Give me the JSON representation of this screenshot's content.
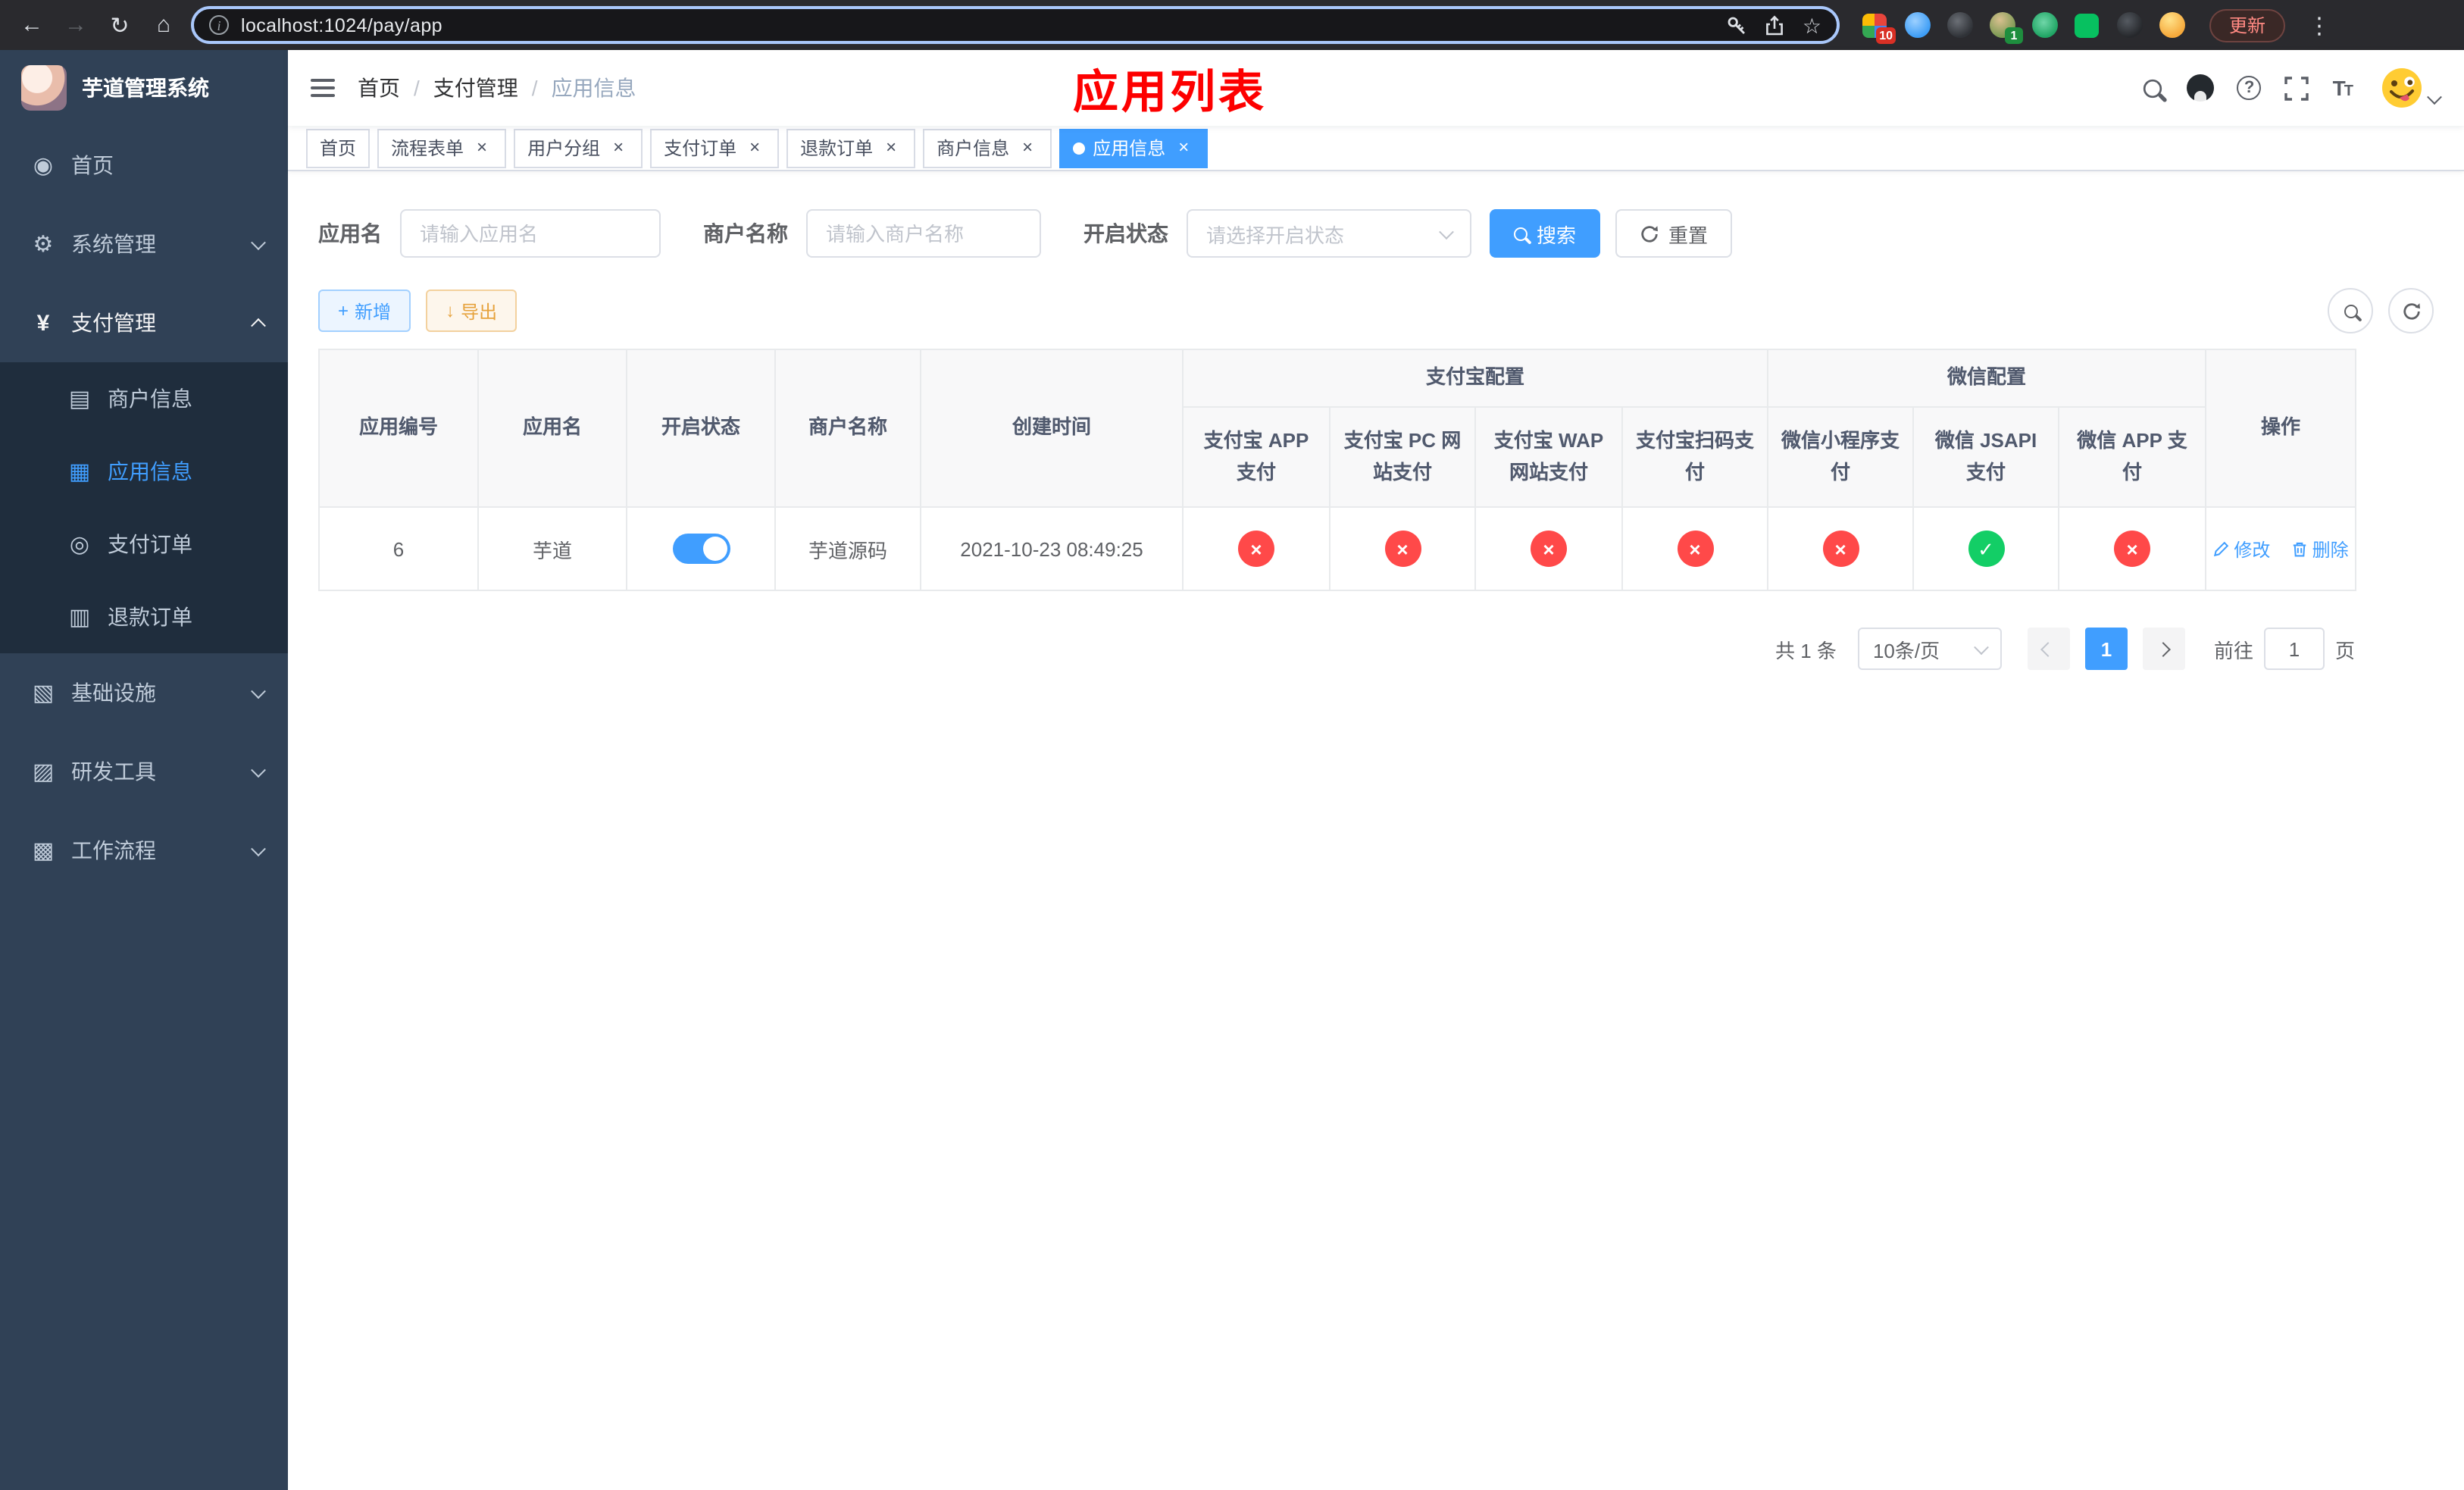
{
  "browser": {
    "url": "localhost:1024/pay/app",
    "update_label": "更新",
    "ext_badge_puzzle": "10",
    "ext_badge_avatar": "1"
  },
  "sidebar": {
    "title": "芋道管理系统",
    "items": [
      {
        "label": "首页"
      },
      {
        "label": "系统管理"
      },
      {
        "label": "支付管理",
        "children": [
          {
            "label": "商户信息"
          },
          {
            "label": "应用信息"
          },
          {
            "label": "支付订单"
          },
          {
            "label": "退款订单"
          }
        ]
      },
      {
        "label": "基础设施"
      },
      {
        "label": "研发工具"
      },
      {
        "label": "工作流程"
      }
    ]
  },
  "header": {
    "breadcrumb": [
      "首页",
      "支付管理",
      "应用信息"
    ],
    "page_title": "应用列表"
  },
  "tabs": [
    {
      "label": "首页"
    },
    {
      "label": "流程表单"
    },
    {
      "label": "用户分组"
    },
    {
      "label": "支付订单"
    },
    {
      "label": "退款订单"
    },
    {
      "label": "商户信息"
    },
    {
      "label": "应用信息"
    }
  ],
  "filters": {
    "app_name_label": "应用名",
    "app_name_placeholder": "请输入应用名",
    "merchant_label": "商户名称",
    "merchant_placeholder": "请输入商户名称",
    "status_label": "开启状态",
    "status_placeholder": "请选择开启状态",
    "search_button": "搜索",
    "reset_button": "重置"
  },
  "toolbar": {
    "add_button": "新增",
    "export_button": "导出"
  },
  "table": {
    "groups": [
      "支付宝配置",
      "微信配置"
    ],
    "columns": [
      "应用编号",
      "应用名",
      "开启状态",
      "商户名称",
      "创建时间",
      "支付宝 APP 支付",
      "支付宝 PC 网站支付",
      "支付宝 WAP 网站支付",
      "支付宝扫码支付",
      "微信小程序支付",
      "微信 JSAPI 支付",
      "微信 APP 支付",
      "操作"
    ],
    "rows": [
      {
        "id": "6",
        "name": "芋道",
        "enabled": true,
        "merchant": "芋道源码",
        "created": "2021-10-23 08:49:25",
        "channels": {
          "alipay_app": false,
          "alipay_pc": false,
          "alipay_wap": false,
          "alipay_qr": false,
          "wx_lite": false,
          "wx_jsapi": true,
          "wx_app": false
        },
        "edit_label": "修改",
        "delete_label": "删除"
      }
    ]
  },
  "pagination": {
    "total_label": "共 1 条",
    "page_size_label": "10条/页",
    "current_page": "1",
    "goto_label": "前往",
    "goto_value": "1",
    "unit_label": "页"
  },
  "icons": {
    "close": "×",
    "cross": "×",
    "check": "✓",
    "plus": "+",
    "download": "↓",
    "kebab": "⋮",
    "back": "←",
    "forward": "→",
    "reload": "↻",
    "home": "⌂",
    "star": "☆",
    "info": "i",
    "question": "?",
    "dashboard": "◉",
    "gear": "⚙",
    "yen": "¥",
    "merchant": "▤",
    "app": "▦",
    "order": "◎",
    "refund": "▥",
    "infra": "▧",
    "tools": "▨",
    "flow": "▩"
  },
  "colors": {
    "primary": "#409eff",
    "success": "#13ce66",
    "danger": "#ff4949",
    "warning": "#e6a23c",
    "title_red": "#fd0000",
    "sidebar_bg": "#304156",
    "submenu_bg": "#1f2d3d"
  }
}
